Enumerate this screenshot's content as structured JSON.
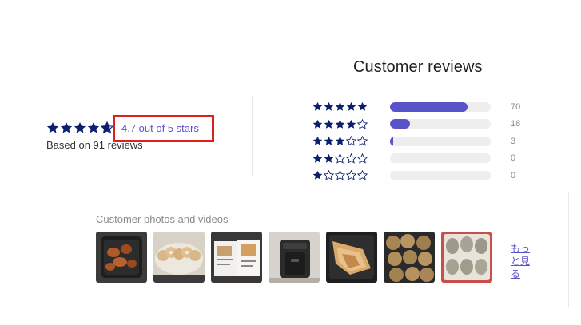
{
  "reviews": {
    "title": "Customer reviews",
    "summary": {
      "average_rating": 4.7,
      "rating_text": "4.7 out of 5 stars",
      "based_on_text": "Based on 91 reviews"
    },
    "histogram": [
      {
        "stars": 5,
        "count_label": "70",
        "fraction": 0.77
      },
      {
        "stars": 4,
        "count_label": "18",
        "fraction": 0.2
      },
      {
        "stars": 3,
        "count_label": "3",
        "fraction": 0.033
      },
      {
        "stars": 2,
        "count_label": "0",
        "fraction": 0
      },
      {
        "stars": 1,
        "count_label": "0",
        "fraction": 0
      }
    ],
    "media": {
      "label": "Customer photos and videos",
      "thumbnails": [
        {
          "name": "photo-air-fryer-basket"
        },
        {
          "name": "photo-lotus-root-dish"
        },
        {
          "name": "photo-recipe-booklet"
        },
        {
          "name": "photo-air-fryer-unit"
        },
        {
          "name": "photo-grilled-fish"
        },
        {
          "name": "photo-fried-balls"
        },
        {
          "name": "photo-breaded-patties"
        }
      ],
      "more_link": "もっと見る"
    },
    "colors": {
      "star": "#0c1f6e",
      "bar_fill": "#5a52c8",
      "bar_track": "#eeeeee",
      "link": "#5a52c8",
      "highlight": "#e0201a"
    }
  }
}
